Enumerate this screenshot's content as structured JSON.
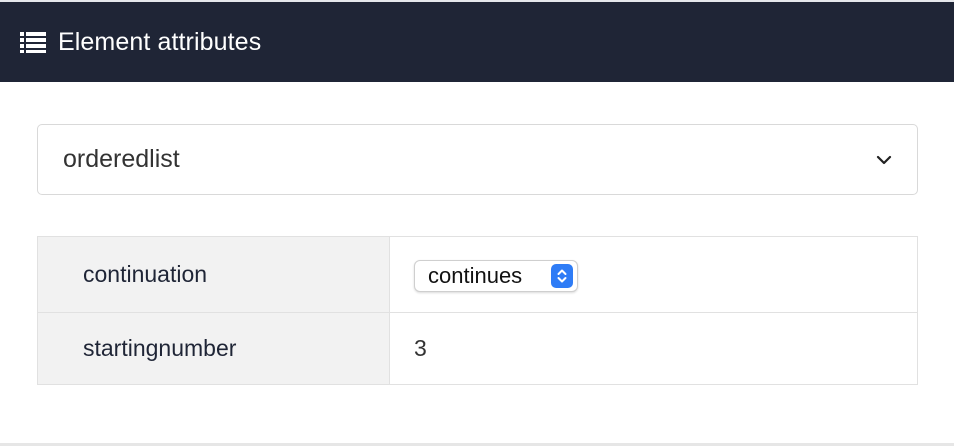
{
  "header": {
    "title": "Element attributes",
    "icon": "list-icon",
    "background": "#1f2536"
  },
  "element_select": {
    "value": "orderedlist",
    "icon": "chevron-down-icon"
  },
  "attributes": [
    {
      "name": "continuation",
      "value": "continues",
      "control": "select",
      "accent": "#2e7cf6"
    },
    {
      "name": "startingnumber",
      "value": "3",
      "control": "text"
    }
  ]
}
